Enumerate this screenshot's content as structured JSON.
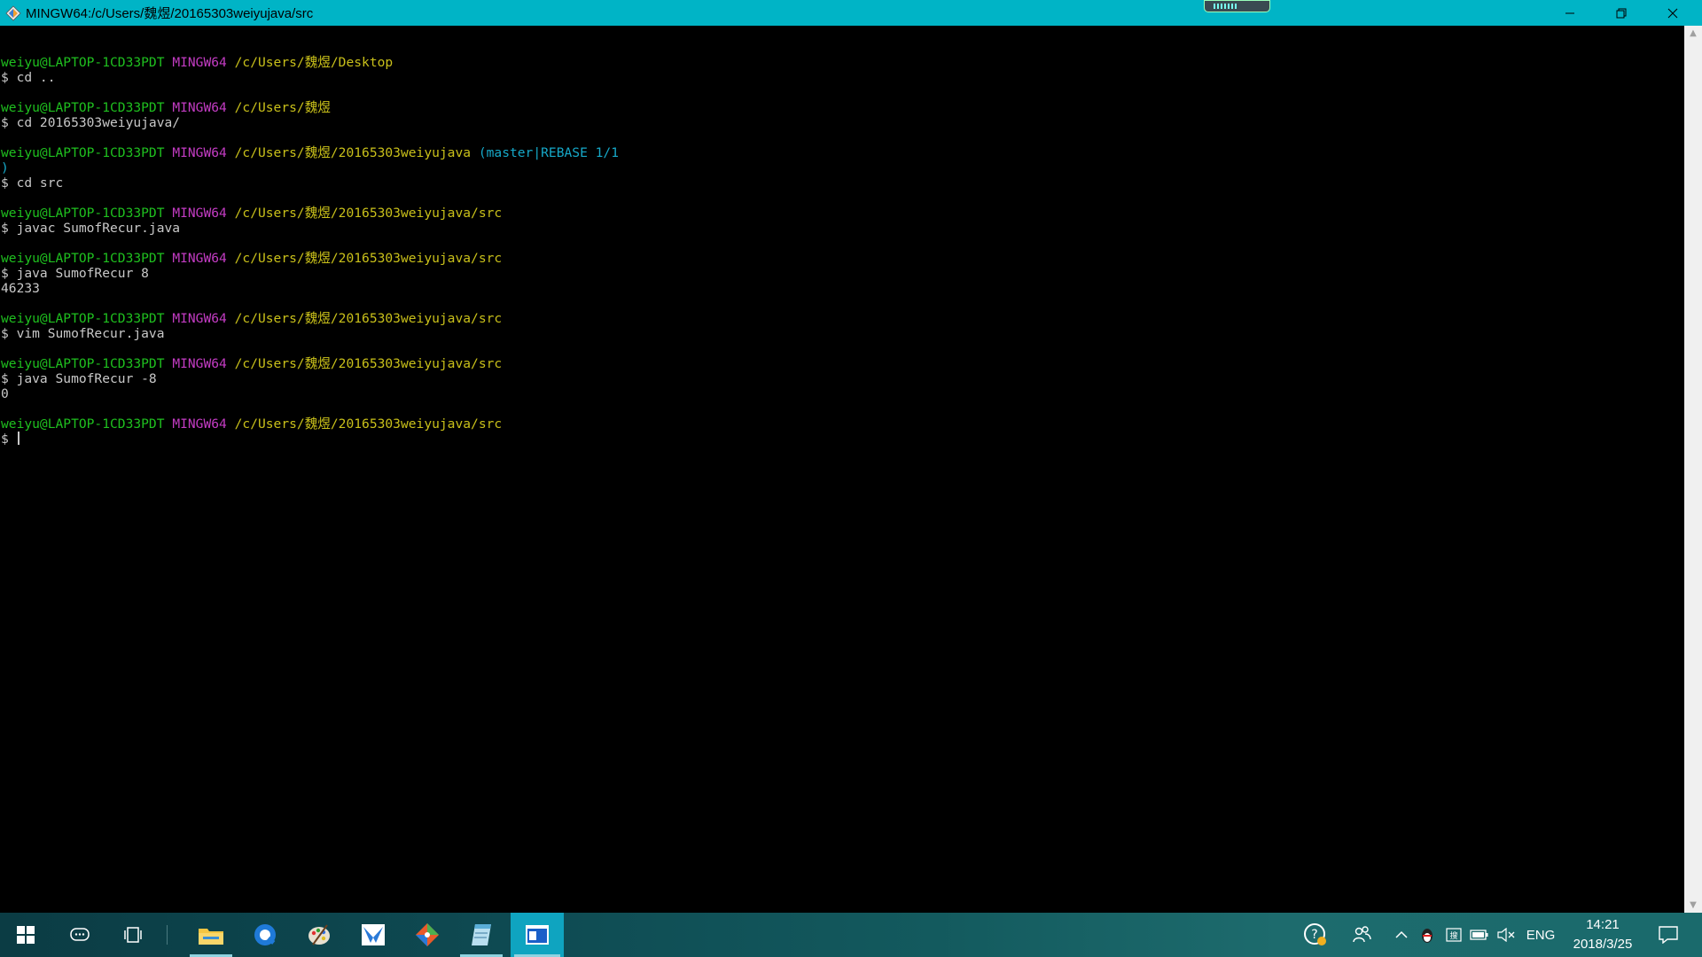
{
  "window": {
    "title": "MINGW64:/c/Users/魏煜/20165303weiyujava/src"
  },
  "terminal": {
    "lines": [
      {
        "user": "weiyu@LAPTOP-1CD33PDT",
        "sys": "MINGW64",
        "path": "/c/Users/魏煜/Desktop",
        "git": ""
      },
      {
        "text": "$ cd .."
      },
      {
        "user": "weiyu@LAPTOP-1CD33PDT",
        "sys": "MINGW64",
        "path": "/c/Users/魏煜",
        "git": ""
      },
      {
        "text": "$ cd 20165303weiyujava/"
      },
      {
        "user": "weiyu@LAPTOP-1CD33PDT",
        "sys": "MINGW64",
        "path": "/c/Users/魏煜/20165303weiyujava",
        "git": "(master|REBASE 1/1"
      },
      {
        "git_cont": ")"
      },
      {
        "text": "$ cd src"
      },
      {
        "user": "weiyu@LAPTOP-1CD33PDT",
        "sys": "MINGW64",
        "path": "/c/Users/魏煜/20165303weiyujava/src",
        "git": ""
      },
      {
        "text": "$ javac SumofRecur.java"
      },
      {
        "user": "weiyu@LAPTOP-1CD33PDT",
        "sys": "MINGW64",
        "path": "/c/Users/魏煜/20165303weiyujava/src",
        "git": ""
      },
      {
        "text": "$ java SumofRecur 8"
      },
      {
        "text": "46233"
      },
      {
        "user": "weiyu@LAPTOP-1CD33PDT",
        "sys": "MINGW64",
        "path": "/c/Users/魏煜/20165303weiyujava/src",
        "git": ""
      },
      {
        "text": "$ vim SumofRecur.java"
      },
      {
        "user": "weiyu@LAPTOP-1CD33PDT",
        "sys": "MINGW64",
        "path": "/c/Users/魏煜/20165303weiyujava/src",
        "git": ""
      },
      {
        "text": "$ java SumofRecur -8"
      },
      {
        "text": "0"
      },
      {
        "user": "weiyu@LAPTOP-1CD33PDT",
        "sys": "MINGW64",
        "path": "/c/Users/魏煜/20165303weiyujava/src",
        "git": ""
      }
    ],
    "prompt": "$ "
  },
  "taskbar": {
    "language": "ENG",
    "time": "14:21",
    "date": "2018/3/25"
  },
  "colors": {
    "titlebar": "#00b4c6",
    "user": "#1fc01f",
    "mingw": "#c33cc3",
    "path": "#c9c01a",
    "git": "#16a9c9"
  }
}
